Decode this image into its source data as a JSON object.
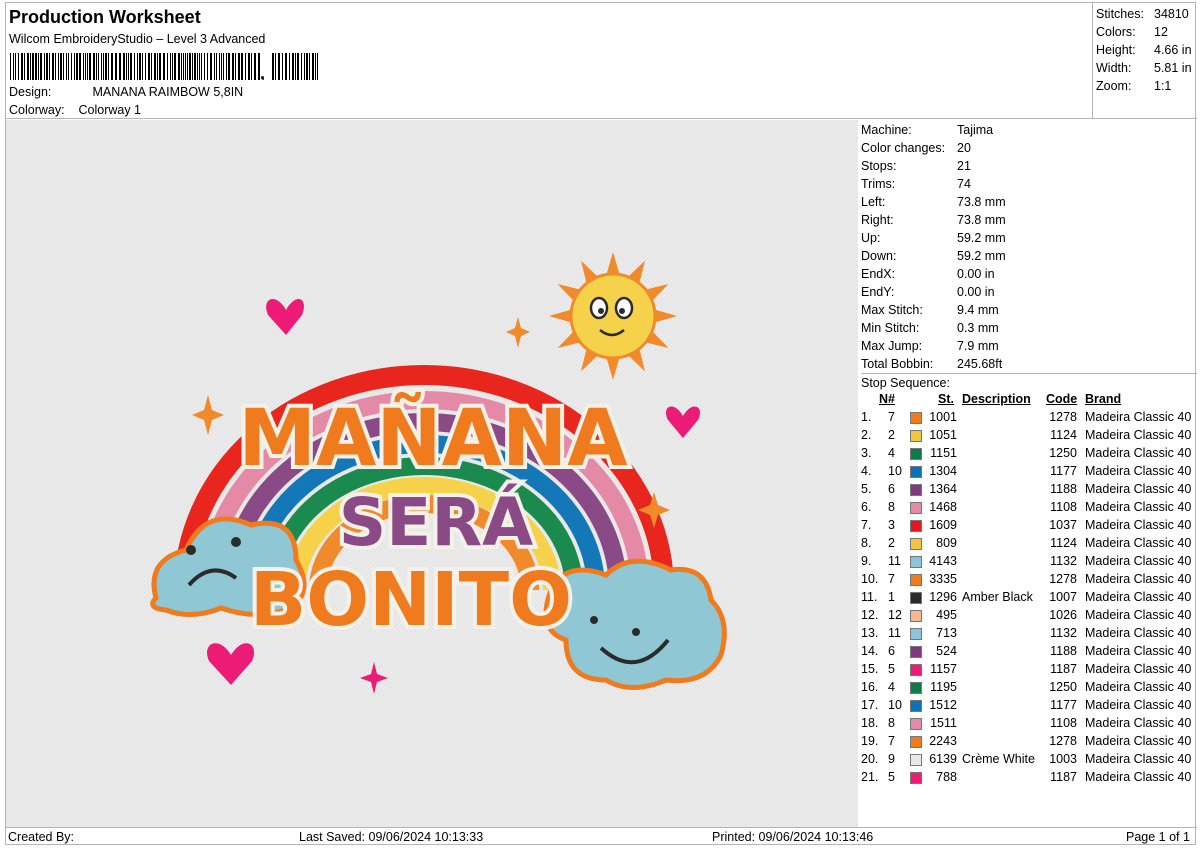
{
  "header": {
    "title": "Production Worksheet",
    "software": "Wilcom EmbroideryStudio – Level 3 Advanced",
    "design_label": "Design:",
    "design_value": "MANANA RAIMBOW 5,8IN",
    "colorway_label": "Colorway:",
    "colorway_value": "Colorway 1"
  },
  "summary": [
    {
      "label": "Stitches:",
      "value": "34810"
    },
    {
      "label": "Colors:",
      "value": "12"
    },
    {
      "label": "Height:",
      "value": "4.66 in"
    },
    {
      "label": "Width:",
      "value": "5.81 in"
    },
    {
      "label": "Zoom:",
      "value": "1:1"
    }
  ],
  "properties": [
    {
      "label": "Machine:",
      "value": "Tajima"
    },
    {
      "label": "Color changes:",
      "value": "20"
    },
    {
      "label": "Stops:",
      "value": "21"
    },
    {
      "label": "Trims:",
      "value": "74"
    },
    {
      "label": "Left:",
      "value": "73.8 mm"
    },
    {
      "label": "Right:",
      "value": "73.8 mm"
    },
    {
      "label": "Up:",
      "value": "59.2 mm"
    },
    {
      "label": "Down:",
      "value": "59.2 mm"
    },
    {
      "label": "EndX:",
      "value": "0.00 in"
    },
    {
      "label": "EndY:",
      "value": "0.00 in"
    },
    {
      "label": "Max Stitch:",
      "value": "9.4 mm"
    },
    {
      "label": "Min Stitch:",
      "value": "0.3 mm"
    },
    {
      "label": "Max Jump:",
      "value": "7.9 mm"
    },
    {
      "label": "Total Bobbin:",
      "value": "245.68ft"
    }
  ],
  "stop_sequence": {
    "label": "Stop Sequence:",
    "headers": {
      "n": "N#",
      "st": "St.",
      "description": "Description",
      "code": "Code",
      "brand": "Brand"
    },
    "rows": [
      {
        "idx": "1.",
        "n": "7",
        "color": "#f07a1e",
        "st": "1001",
        "desc": "",
        "code": "1278",
        "brand": "Madeira Classic 40"
      },
      {
        "idx": "2.",
        "n": "2",
        "color": "#f5c342",
        "st": "1051",
        "desc": "",
        "code": "1124",
        "brand": "Madeira Classic 40"
      },
      {
        "idx": "3.",
        "n": "4",
        "color": "#0f7a4a",
        "st": "1151",
        "desc": "",
        "code": "1250",
        "brand": "Madeira Classic 40"
      },
      {
        "idx": "4.",
        "n": "10",
        "color": "#0a73b8",
        "st": "1304",
        "desc": "",
        "code": "1177",
        "brand": "Madeira Classic 40"
      },
      {
        "idx": "5.",
        "n": "6",
        "color": "#7d3a80",
        "st": "1364",
        "desc": "",
        "code": "1188",
        "brand": "Madeira Classic 40"
      },
      {
        "idx": "6.",
        "n": "8",
        "color": "#e58aa6",
        "st": "1468",
        "desc": "",
        "code": "1108",
        "brand": "Madeira Classic 40"
      },
      {
        "idx": "7.",
        "n": "3",
        "color": "#e8141e",
        "st": "1609",
        "desc": "",
        "code": "1037",
        "brand": "Madeira Classic 40"
      },
      {
        "idx": "8.",
        "n": "2",
        "color": "#f5c342",
        "st": "809",
        "desc": "",
        "code": "1124",
        "brand": "Madeira Classic 40"
      },
      {
        "idx": "9.",
        "n": "11",
        "color": "#8fc3dc",
        "st": "4143",
        "desc": "",
        "code": "1132",
        "brand": "Madeira Classic 40"
      },
      {
        "idx": "10.",
        "n": "7",
        "color": "#f07a1e",
        "st": "3335",
        "desc": "",
        "code": "1278",
        "brand": "Madeira Classic 40"
      },
      {
        "idx": "11.",
        "n": "1",
        "color": "#2b2b2b",
        "st": "1296",
        "desc": "Amber Black",
        "code": "1007",
        "brand": "Madeira Classic 40"
      },
      {
        "idx": "12.",
        "n": "12",
        "color": "#f5b78e",
        "st": "495",
        "desc": "",
        "code": "1026",
        "brand": "Madeira Classic 40"
      },
      {
        "idx": "13.",
        "n": "11",
        "color": "#8fc3dc",
        "st": "713",
        "desc": "",
        "code": "1132",
        "brand": "Madeira Classic 40"
      },
      {
        "idx": "14.",
        "n": "6",
        "color": "#7d3a80",
        "st": "524",
        "desc": "",
        "code": "1188",
        "brand": "Madeira Classic 40"
      },
      {
        "idx": "15.",
        "n": "5",
        "color": "#ec1b75",
        "st": "1157",
        "desc": "",
        "code": "1187",
        "brand": "Madeira Classic 40"
      },
      {
        "idx": "16.",
        "n": "4",
        "color": "#0f7a4a",
        "st": "1195",
        "desc": "",
        "code": "1250",
        "brand": "Madeira Classic 40"
      },
      {
        "idx": "17.",
        "n": "10",
        "color": "#0a73b8",
        "st": "1512",
        "desc": "",
        "code": "1177",
        "brand": "Madeira Classic 40"
      },
      {
        "idx": "18.",
        "n": "8",
        "color": "#e58aa6",
        "st": "1511",
        "desc": "",
        "code": "1108",
        "brand": "Madeira Classic 40"
      },
      {
        "idx": "19.",
        "n": "7",
        "color": "#f07a1e",
        "st": "2243",
        "desc": "",
        "code": "1278",
        "brand": "Madeira Classic 40"
      },
      {
        "idx": "20.",
        "n": "9",
        "color": "#e8e8e4",
        "st": "6139",
        "desc": "Crème White",
        "code": "1003",
        "brand": "Madeira Classic 40"
      },
      {
        "idx": "21.",
        "n": "5",
        "color": "#ec1b75",
        "st": "788",
        "desc": "",
        "code": "1187",
        "brand": "Madeira Classic 40"
      }
    ]
  },
  "design_preview": {
    "line1": "MAÑANA",
    "line2": "SERÁ",
    "line3": "BONITO"
  },
  "footer": {
    "created_by": "Created By:",
    "last_saved": "Last Saved: 09/06/2024 10:13:33",
    "printed": "Printed: 09/06/2024 10:13:46",
    "page": "Page 1 of 1"
  }
}
